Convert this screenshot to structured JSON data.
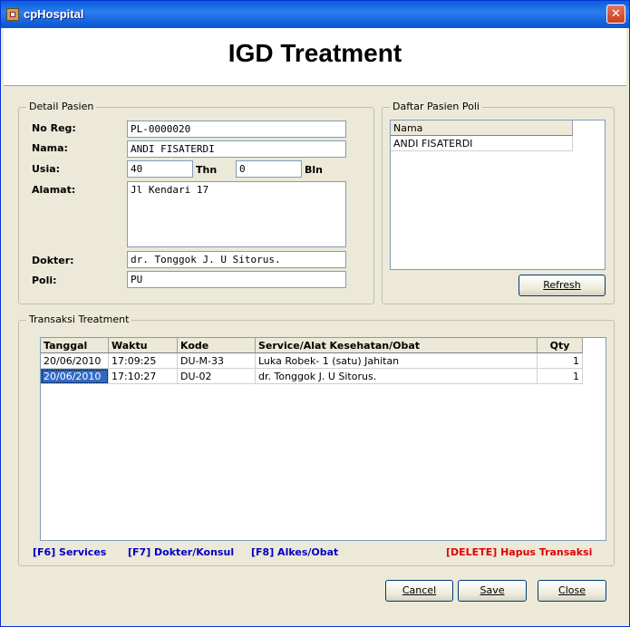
{
  "window": {
    "title": "cpHospital"
  },
  "header": {
    "title": "IGD Treatment"
  },
  "detail": {
    "legend": "Detail Pasien",
    "no_reg_label": "No Reg:",
    "no_reg_value": "PL-0000020",
    "nama_label": "Nama:",
    "nama_value": "ANDI FISATERDI",
    "usia_label": "Usia:",
    "usia_thn_value": "40",
    "thn_label": "Thn",
    "usia_bln_value": "0",
    "bln_label": "Bln",
    "alamat_label": "Alamat:",
    "alamat_value": "Jl Kendari 17",
    "dokter_label": "Dokter:",
    "dokter_value": "dr. Tonggok J. U Sitorus.",
    "poli_label": "Poli:",
    "poli_value": "PU"
  },
  "daftar": {
    "legend": "Daftar Pasien Poli",
    "column": "Nama",
    "rows": [
      "ANDI FISATERDI"
    ],
    "refresh_label": "Refresh"
  },
  "transaksi": {
    "legend": "Transaksi Treatment",
    "columns": [
      "Tanggal",
      "Waktu",
      "Kode",
      "Service/Alat Kesehatan/Obat",
      "Qty"
    ],
    "rows": [
      [
        "20/06/2010",
        "17:09:25",
        "DU-M-33",
        "Luka Robek- 1 (satu) Jahitan",
        "1"
      ],
      [
        "20/06/2010",
        "17:10:27",
        "DU-02",
        "dr. Tonggok J. U Sitorus.",
        "1"
      ]
    ],
    "selected_cell": "row 2, Tanggal",
    "hints": {
      "services": "[F6] Services",
      "dokter": "[F7] Dokter/Konsul",
      "alkes": "[F8] Alkes/Obat",
      "delete": "[DELETE] Hapus Transaksi"
    }
  },
  "buttons": {
    "cancel": "Cancel",
    "save": "Save",
    "close": "Close"
  },
  "colors": {
    "titlebar": "#0a5fd8",
    "selection": "#316ac5",
    "hint_blue": "#0000c0",
    "hint_red": "#e00000"
  },
  "icons": {
    "app": "hospital-app-icon",
    "close": "close-icon"
  }
}
